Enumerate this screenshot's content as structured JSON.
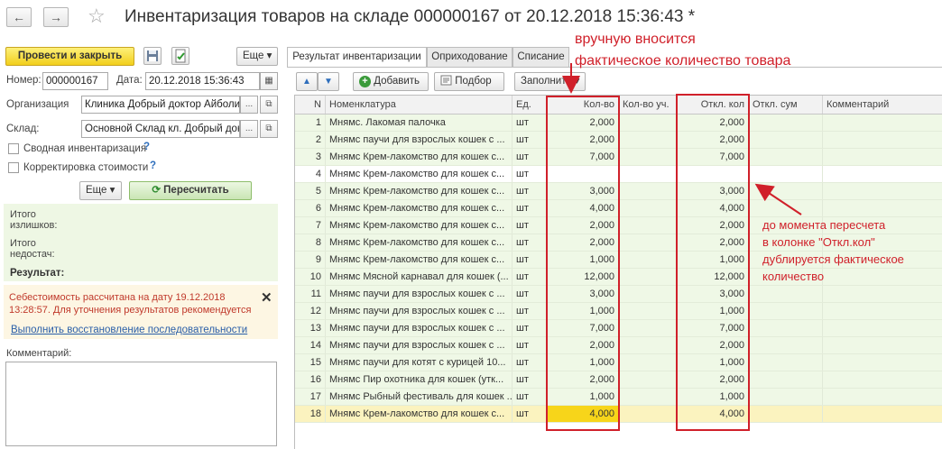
{
  "header": {
    "back_icon": "←",
    "forward_icon": "→",
    "star_icon": "☆",
    "title": "Инвентаризация товаров на складе 000000167 от 20.12.2018 15:36:43 *"
  },
  "toolbar": {
    "post_close": "Провести и закрыть",
    "more": "Еще",
    "more_arrow": "▾"
  },
  "form": {
    "number_label": "Номер:",
    "number": "000000167",
    "date_label": "Дата:",
    "date": "20.12.2018 15:36:43",
    "org_label": "Организация",
    "org": "Клиника Добрый доктор Айболит",
    "warehouse_label": "Склад:",
    "warehouse": "Основной Склад кл. Добрый доктор",
    "consolidated": "Сводная инвентаризация",
    "cost_adjust": "Корректировка стоимости",
    "help": "?",
    "dots": "...",
    "open_icon": "⧉",
    "calendar_icon": "▦",
    "more": "Еще",
    "recalc": "Пересчитать",
    "recalc_icon": "⟳"
  },
  "totals": {
    "surplus_label": "Итого\nизлишков:",
    "shortage_label": "Итого\nнедостач:",
    "result_label": "Результат:"
  },
  "warning": {
    "text": "Себестоимость рассчитана на дату 19.12.2018 13:28:57. Для уточнения результатов рекомендуется",
    "link": "Выполнить восстановление последовательности",
    "close_icon": "✕"
  },
  "comment_label": "Комментарий:",
  "tabs": [
    "Результат инвентаризации",
    "Оприходование",
    "Списание"
  ],
  "table_toolbar": {
    "up_icon": "▲",
    "down_icon": "▼",
    "add": "Добавить",
    "add_icon": "+",
    "select": "Подбор",
    "fill": "Заполнить",
    "fill_arrow": "▾"
  },
  "table": {
    "columns": [
      "N",
      "Номенклатура",
      "Ед.",
      "Кол-во",
      "Кол-во уч.",
      "Откл. кол",
      "Откл. сум",
      "Комментарий"
    ],
    "rows": [
      {
        "n": "1",
        "name": "Мнямс. Лакомая палочка",
        "unit": "шт",
        "qty": "2,000",
        "dev": "2,000"
      },
      {
        "n": "2",
        "name": "Мнямс паучи для взрослых кошек с ...",
        "unit": "шт",
        "qty": "2,000",
        "dev": "2,000"
      },
      {
        "n": "3",
        "name": "Мнямс Крем-лакомство для кошек с...",
        "unit": "шт",
        "qty": "7,000",
        "dev": "7,000"
      },
      {
        "n": "4",
        "name": "Мнямс Крем-лакомство для кошек с...",
        "unit": "шт",
        "qty": "",
        "dev": ""
      },
      {
        "n": "5",
        "name": "Мнямс Крем-лакомство для кошек с...",
        "unit": "шт",
        "qty": "3,000",
        "dev": "3,000"
      },
      {
        "n": "6",
        "name": "Мнямс Крем-лакомство для кошек с...",
        "unit": "шт",
        "qty": "4,000",
        "dev": "4,000"
      },
      {
        "n": "7",
        "name": "Мнямс Крем-лакомство для кошек с...",
        "unit": "шт",
        "qty": "2,000",
        "dev": "2,000"
      },
      {
        "n": "8",
        "name": "Мнямс Крем-лакомство для кошек с...",
        "unit": "шт",
        "qty": "2,000",
        "dev": "2,000"
      },
      {
        "n": "9",
        "name": "Мнямс Крем-лакомство для кошек с...",
        "unit": "шт",
        "qty": "1,000",
        "dev": "1,000"
      },
      {
        "n": "10",
        "name": "Мнямс Мясной карнавал для кошек (...",
        "unit": "шт",
        "qty": "12,000",
        "dev": "12,000"
      },
      {
        "n": "11",
        "name": "Мнямс паучи для взрослых кошек с ...",
        "unit": "шт",
        "qty": "3,000",
        "dev": "3,000"
      },
      {
        "n": "12",
        "name": "Мнямс паучи для взрослых кошек с ...",
        "unit": "шт",
        "qty": "1,000",
        "dev": "1,000"
      },
      {
        "n": "13",
        "name": "Мнямс паучи для взрослых кошек с ...",
        "unit": "шт",
        "qty": "7,000",
        "dev": "7,000"
      },
      {
        "n": "14",
        "name": "Мнямс паучи для взрослых кошек с ...",
        "unit": "шт",
        "qty": "2,000",
        "dev": "2,000"
      },
      {
        "n": "15",
        "name": "Мнямс паучи для котят с курицей 10...",
        "unit": "шт",
        "qty": "1,000",
        "dev": "1,000"
      },
      {
        "n": "16",
        "name": "Мнямс Пир охотника для кошек (утк...",
        "unit": "шт",
        "qty": "2,000",
        "dev": "2,000"
      },
      {
        "n": "17",
        "name": "Мнямс Рыбный фестиваль для кошек ...",
        "unit": "шт",
        "qty": "1,000",
        "dev": "1,000"
      },
      {
        "n": "18",
        "name": "Мнямс Крем-лакомство для кошек с...",
        "unit": "шт",
        "qty": "4,000",
        "dev": "4,000"
      }
    ]
  },
  "annotations": {
    "top_note_line1": "вручную вносится",
    "top_note_line2": "фактическое количество товара",
    "side_note_line1": "до момента пересчета",
    "side_note_line2": "в колонке \"Откл.кол\"",
    "side_note_line3": "дублируется фактическое",
    "side_note_line4": "количество",
    "color": "#d0202a"
  }
}
